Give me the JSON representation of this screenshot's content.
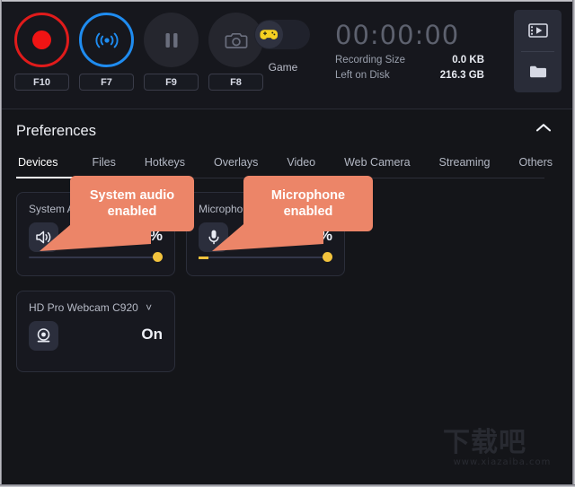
{
  "app": {
    "background": "#14151b",
    "accent_yellow": "#f2c33d",
    "callout_color": "#ec8568"
  },
  "toolbar": {
    "controls": [
      {
        "name": "record",
        "icon": "record-icon",
        "hotkey": "F10",
        "enabled": true,
        "color": "#e01b1b"
      },
      {
        "name": "stream",
        "icon": "broadcast-icon",
        "hotkey": "F7",
        "enabled": true,
        "color": "#1f8cf0"
      },
      {
        "name": "pause",
        "icon": "pause-icon",
        "hotkey": "F9",
        "enabled": false,
        "color": "#6a6e7d"
      },
      {
        "name": "screenshot",
        "icon": "camera-icon",
        "hotkey": "F8",
        "enabled": false,
        "color": "#6a6e7d"
      }
    ],
    "game_toggle": {
      "label": "Game",
      "icon": "gamepad-icon",
      "state": "off"
    },
    "status": {
      "timer": "00:00:00",
      "recording_size_label": "Recording Size",
      "recording_size_value": "0.0 KB",
      "left_on_disk_label": "Left on Disk",
      "left_on_disk_value": "216.3 GB"
    },
    "side_buttons": [
      {
        "name": "open-video-library",
        "icon": "film-icon"
      },
      {
        "name": "open-folder",
        "icon": "folder-icon"
      }
    ]
  },
  "preferences": {
    "title": "Preferences",
    "collapse_icon": "chevron-up-icon",
    "tabs": [
      {
        "label": "Devices",
        "active": true
      },
      {
        "label": "Files",
        "active": false
      },
      {
        "label": "Hotkeys",
        "active": false
      },
      {
        "label": "Overlays",
        "active": false
      },
      {
        "label": "Video",
        "active": false
      },
      {
        "label": "Web Camera",
        "active": false
      },
      {
        "label": "Streaming",
        "active": false
      },
      {
        "label": "Others",
        "active": false
      }
    ],
    "devices": {
      "system_audio": {
        "title": "System A",
        "icon": "speaker-icon",
        "volume": "100%",
        "slider_percent": 100,
        "level_meter": false
      },
      "microphone": {
        "title": "Micropho",
        "icon": "microphone-icon",
        "volume": "100%",
        "slider_percent": 100,
        "level_meter": true
      },
      "webcam": {
        "title": "HD Pro Webcam C920",
        "dropdown_icon": "chevron-down-icon",
        "icon": "webcam-icon",
        "state": "On"
      }
    }
  },
  "callouts": [
    {
      "name": "system-audio-callout",
      "line1": "System audio",
      "line2": "enabled"
    },
    {
      "name": "microphone-callout",
      "line1": "Microphone",
      "line2": "enabled"
    }
  ],
  "watermark": {
    "title": "下载吧",
    "url": "www.xiazaiba.com"
  }
}
